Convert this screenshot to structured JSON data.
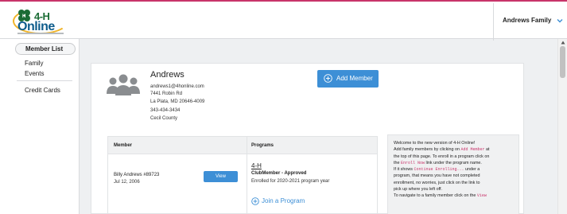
{
  "header": {
    "logo": {
      "text_4h": "4-H",
      "text_online": "Online"
    },
    "family_menu": {
      "label": "Andrews Family",
      "icon": "chevron-down-icon"
    }
  },
  "sidebar": {
    "active_item": "Member List",
    "items": [
      "Family",
      "Events",
      "Credit Cards"
    ]
  },
  "family": {
    "name": "Andrews",
    "email": "andrews1@4honline.com",
    "address_line1": "7441 Robin Rd",
    "address_line2": "La Plata, MD 20646-4009",
    "phone": "343-434-3434",
    "county": "Cecil County"
  },
  "actions": {
    "add_member": "Add Member"
  },
  "members_table": {
    "headers": {
      "member": "Member",
      "programs": "Programs"
    },
    "rows": [
      {
        "name": "Billy Andrews #89723",
        "dob": "Jul 12, 2006",
        "view_label": "View",
        "program": "4-H",
        "status": "ClubMember - Approved",
        "enrollment": "Enrolled for 2020-2021 program year",
        "join_label": "Join a Program"
      }
    ]
  },
  "info_box": {
    "l1": "Welcome to the new version of 4-H Online!",
    "l2a": "Add family members by clicking on ",
    "l2code": "Add Member",
    "l2b": " at",
    "l3": "the top of this page. To enroll in a program click on",
    "l4a": "the ",
    "l4code": "Enroll Now",
    "l4b": " link under the program name.",
    "l5a": "If it shows ",
    "l5code": "Continue Enrolling...",
    "l5b": " under a",
    "l6": "program, that means you have not completed",
    "l7": "enrollment, no worries, just click on the link to",
    "l8": "pick up where you left off.",
    "l9a": "To navigate to a family member click on the ",
    "l9code": "View"
  },
  "colors": {
    "accent": "#3d8fd6",
    "brand_pink": "#c8346a",
    "brand_green": "#1b6c35",
    "brand_blue": "#0e5c8c"
  }
}
